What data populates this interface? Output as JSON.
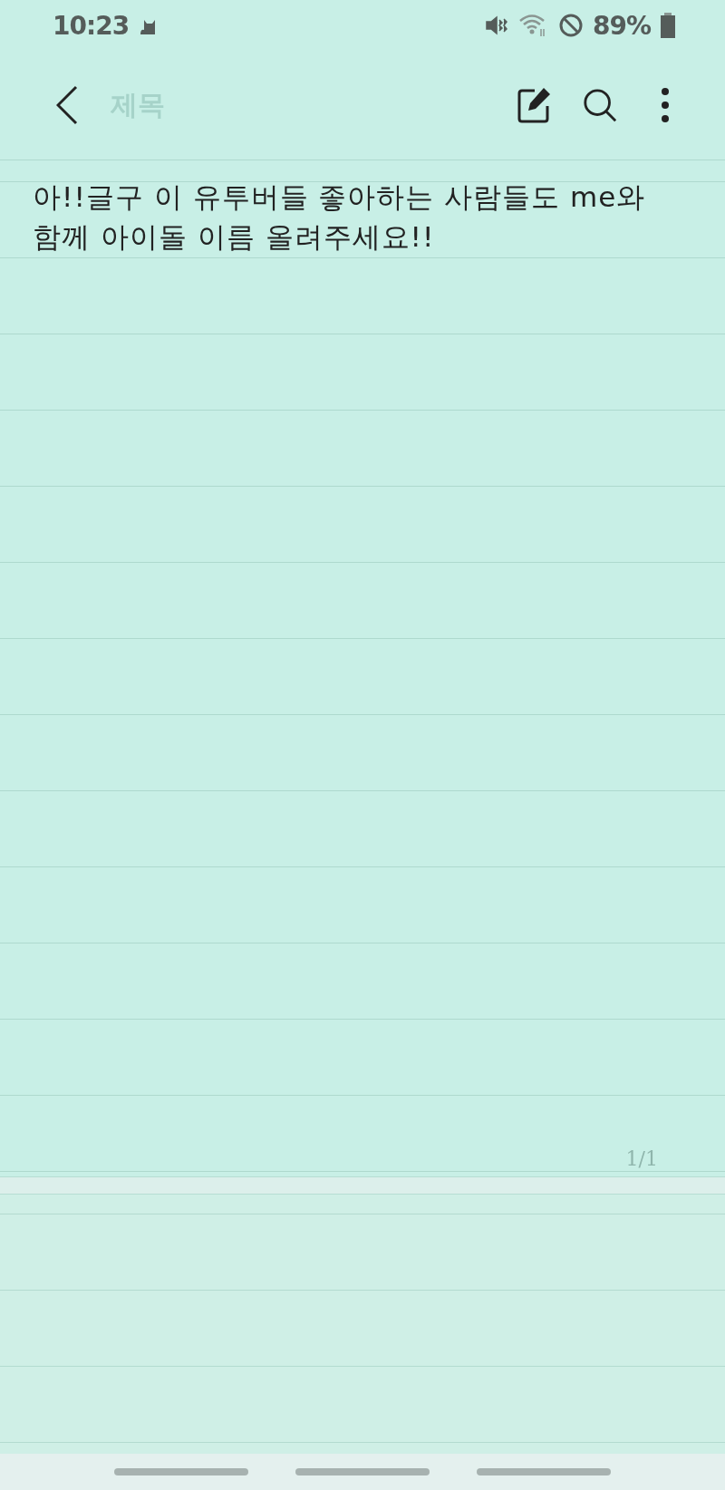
{
  "status_bar": {
    "time": "10:23",
    "battery": "89%"
  },
  "toolbar": {
    "title": {
      "placeholder": "제목"
    }
  },
  "note": {
    "lines": [
      "아!!글구 이 유투버들 좋아하는 사람들도 me와",
      "함께 아이돌 이름 올려주세요!!"
    ]
  },
  "page_indicator": "1/1"
}
